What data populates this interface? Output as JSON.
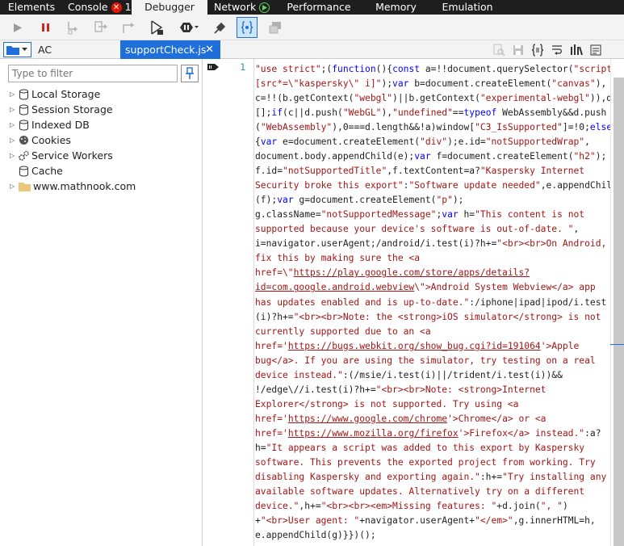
{
  "tabs": [
    {
      "label": "Elements"
    },
    {
      "label": "Console",
      "badge": "1"
    },
    {
      "label": "Debugger"
    },
    {
      "label": "Network"
    },
    {
      "label": "Performance"
    },
    {
      "label": "Memory"
    },
    {
      "label": "Emulation"
    }
  ],
  "active_tab": "Debugger",
  "files": {
    "workspace_label": "AC",
    "open_file": "supportCheck.js"
  },
  "sidebar": {
    "filter_placeholder": "Type to filter",
    "items": [
      {
        "label": "Local Storage"
      },
      {
        "label": "Session Storage"
      },
      {
        "label": "Indexed DB"
      },
      {
        "label": "Cookies"
      },
      {
        "label": "Service Workers"
      },
      {
        "label": "Cache"
      },
      {
        "label": "www.mathnook.com"
      }
    ]
  },
  "editor": {
    "line_number": "1",
    "code_lines": [
      [
        [
          "s",
          "\"use strict\""
        ],
        [
          "t",
          ";("
        ],
        [
          "k",
          "function"
        ],
        [
          "t",
          "(){"
        ],
        [
          "k",
          "const"
        ],
        [
          "t",
          " a=!!document.querySelector("
        ],
        [
          "s",
          "\"script"
        ]
      ],
      [
        [
          "s",
          "[src*=\\\"kaspersky\\\" i]\""
        ],
        [
          "t",
          ");"
        ],
        [
          "k",
          "var"
        ],
        [
          "t",
          " b=document.createElement("
        ],
        [
          "s",
          "\"canvas\""
        ],
        [
          "t",
          "),"
        ]
      ],
      [
        [
          "t",
          "c=!!(b.getContext("
        ],
        [
          "s",
          "\"webgl\""
        ],
        [
          "t",
          ")||b.getContext("
        ],
        [
          "s",
          "\"experimental-webgl\""
        ],
        [
          "t",
          ")),d="
        ]
      ],
      [
        [
          "t",
          "[];"
        ],
        [
          "k",
          "if"
        ],
        [
          "t",
          "(c||d.push("
        ],
        [
          "s",
          "\"WebGL\""
        ],
        [
          "t",
          "),"
        ],
        [
          "s",
          "\"undefined\""
        ],
        [
          "t",
          "=="
        ],
        [
          "k",
          "typeof"
        ],
        [
          "t",
          " WebAssembly&&d.push"
        ]
      ],
      [
        [
          "t",
          "("
        ],
        [
          "s",
          "\"WebAssembly\""
        ],
        [
          "t",
          "),0===d.length&&!a)window["
        ],
        [
          "s",
          "\"C3_IsSupported\""
        ],
        [
          "t",
          "]=!0;"
        ],
        [
          "k",
          "else"
        ]
      ],
      [
        [
          "t",
          "{"
        ],
        [
          "k",
          "var"
        ],
        [
          "t",
          " e=document.createElement("
        ],
        [
          "s",
          "\"div\""
        ],
        [
          "t",
          ");e.id="
        ],
        [
          "s",
          "\"notSupportedWrap\""
        ],
        [
          "t",
          ","
        ]
      ],
      [
        [
          "t",
          "document.body.appendChild(e);"
        ],
        [
          "k",
          "var"
        ],
        [
          "t",
          " f=document.createElement("
        ],
        [
          "s",
          "\"h2\""
        ],
        [
          "t",
          ");"
        ]
      ],
      [
        [
          "t",
          "f.id="
        ],
        [
          "s",
          "\"notSupportedTitle\""
        ],
        [
          "t",
          ",f.textContent=a?"
        ],
        [
          "s",
          "\"Kaspersky Internet"
        ]
      ],
      [
        [
          "s",
          "Security broke this export\""
        ],
        [
          "t",
          ":"
        ],
        [
          "s",
          "\"Software update needed\""
        ],
        [
          "t",
          ",e.appendChild"
        ]
      ],
      [
        [
          "t",
          "(f);"
        ],
        [
          "k",
          "var"
        ],
        [
          "t",
          " g=document.createElement("
        ],
        [
          "s",
          "\"p\""
        ],
        [
          "t",
          ");"
        ]
      ],
      [
        [
          "t",
          "g.className="
        ],
        [
          "s",
          "\"notSupportedMessage\""
        ],
        [
          "t",
          ";"
        ],
        [
          "k",
          "var"
        ],
        [
          "t",
          " h="
        ],
        [
          "s",
          "\"This content is not"
        ]
      ],
      [
        [
          "s",
          "supported because your device's software is out-of-date. \""
        ],
        [
          "t",
          ","
        ]
      ],
      [
        [
          "t",
          "i=navigator.userAgent;/android/i.test(i)?h+="
        ],
        [
          "s",
          "\"<br><br>On Android,"
        ]
      ],
      [
        [
          "s",
          "fix this by making sure the <a"
        ]
      ],
      [
        [
          "s",
          "href=\\\""
        ],
        [
          "u",
          "https://play.google.com/store/apps/details?"
        ]
      ],
      [
        [
          "u",
          "id=com.google.android.webview"
        ],
        [
          "s",
          "\\\">Android System Webview</a> app"
        ]
      ],
      [
        [
          "s",
          "has updates enabled and is up-to-date.\""
        ],
        [
          "t",
          ":/iphone|ipad|ipod/i.test"
        ]
      ],
      [
        [
          "t",
          "(i)?h+="
        ],
        [
          "s",
          "\"<br><br>Note: the <strong>iOS simulator</strong> is not"
        ]
      ],
      [
        [
          "s",
          "currently supported due to an <a"
        ]
      ],
      [
        [
          "s",
          "href='"
        ],
        [
          "u",
          "https://bugs.webkit.org/show_bug.cgi?id=191064"
        ],
        [
          "s",
          "'>Apple"
        ]
      ],
      [
        [
          "s",
          "bug</a>. If you are using the simulator, try testing on a real"
        ]
      ],
      [
        [
          "s",
          "device instead.\""
        ],
        [
          "t",
          ":(/msie/i.test(i)||/trident/i.test(i))&&"
        ]
      ],
      [
        [
          "t",
          "!/edge\\//i.test(i)?h+="
        ],
        [
          "s",
          "\"<br><br>Note: <strong>Internet"
        ]
      ],
      [
        [
          "s",
          "Explorer</strong> is not supported. Try using <a"
        ]
      ],
      [
        [
          "s",
          "href='"
        ],
        [
          "u",
          "https://www.google.com/chrome"
        ],
        [
          "s",
          "'>Chrome</a> or <a"
        ]
      ],
      [
        [
          "s",
          "href='"
        ],
        [
          "u",
          "https://www.mozilla.org/firefox"
        ],
        [
          "s",
          "'>Firefox</a> instead.\""
        ],
        [
          "t",
          ":a?"
        ]
      ],
      [
        [
          "t",
          "h="
        ],
        [
          "s",
          "\"It appears a script was added to this export by Kaspersky"
        ]
      ],
      [
        [
          "s",
          "software. This prevents the exported project from working. Try"
        ]
      ],
      [
        [
          "s",
          "disabling Kaspersky and exporting again.\""
        ],
        [
          "t",
          ":h+="
        ],
        [
          "s",
          "\"Try installing any"
        ]
      ],
      [
        [
          "s",
          "available software updates. Alternatively try on a different"
        ]
      ],
      [
        [
          "s",
          "device.\""
        ],
        [
          "t",
          ",h+="
        ],
        [
          "s",
          "\"<br><br><em>Missing features: \""
        ],
        [
          "t",
          "+d.join("
        ],
        [
          "s",
          "\", \""
        ],
        [
          "t",
          ")"
        ]
      ],
      [
        [
          "t",
          "+"
        ],
        [
          "s",
          "\"<br>User agent: \""
        ],
        [
          "t",
          "+navigator.userAgent+"
        ],
        [
          "s",
          "\"</em>\""
        ],
        [
          "t",
          ",g.innerHTML=h,"
        ]
      ],
      [
        [
          "t",
          "e.appendChild(g)}})();"
        ]
      ]
    ]
  },
  "colors": {
    "keyword": "#0000ff",
    "string": "#a31515",
    "text": "#1e1e1e",
    "accent": "#1e6fd9",
    "tab_bg": "#1e1e1e"
  }
}
